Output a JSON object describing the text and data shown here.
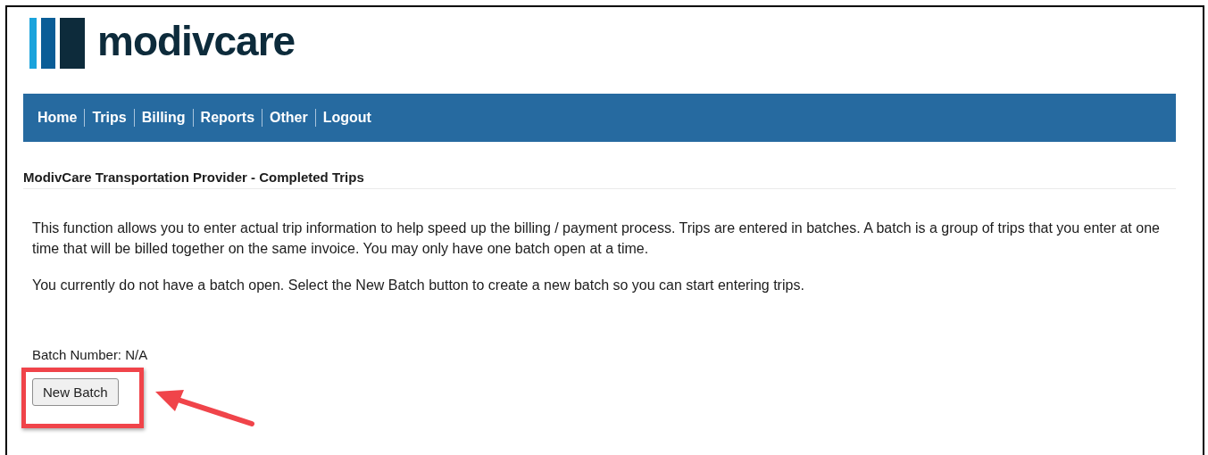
{
  "logo": {
    "text": "modivcare"
  },
  "nav": {
    "items": [
      {
        "label": "Home"
      },
      {
        "label": "Trips"
      },
      {
        "label": "Billing"
      },
      {
        "label": "Reports"
      },
      {
        "label": "Other"
      },
      {
        "label": "Logout"
      }
    ]
  },
  "page_title": "ModivCare Transportation Provider - Completed Trips",
  "paragraphs": [
    "This function allows you to enter actual trip information to help speed up the billing / payment process. Trips are entered in batches. A batch is a group of trips that you enter at one time that will be billed together on the same invoice. You may only have one batch open at a time.",
    "You currently do not have a batch open. Select the New Batch button to create a new batch so you can start entering trips."
  ],
  "batch_number": "Batch Number: N/A",
  "button": {
    "label": "New Batch"
  }
}
